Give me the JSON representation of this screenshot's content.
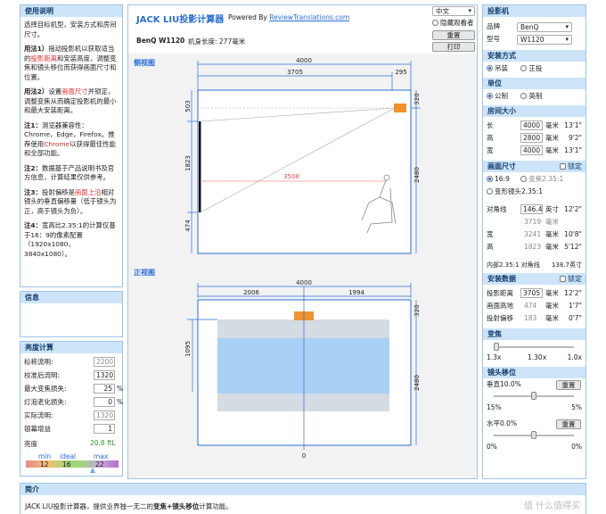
{
  "left": {
    "usage_title": "使用说明",
    "intro": "选择目标机型，安装方式和房间尺寸。",
    "method1_a": "用法1）",
    "method1_b": "拖动投影机以获取适当的",
    "method1_red": "投影距离",
    "method1_c": "和安装高度，调整变焦和镜头移位而获得画面尺寸和位置。",
    "method2_a": "用法2）",
    "method2_b": "设置",
    "method2_red": "画面尺寸",
    "method2_c": "并锁定，调整变焦从而确定投影机的最小和最大安装距离。",
    "note1_a": "注1：",
    "note1_b": "测览器兼容性：Chrome，Edge，Firefox。推荐使用",
    "note1_red": "Chrome",
    "note1_c": "以获得最佳性能和全部功能。",
    "note2_a": "注2：",
    "note2_b": "数据基于产品说明书及官方信息，计算结果仅供参考。",
    "note3_a": "注3：",
    "note3_b": "投射偏移是",
    "note3_red": "画面上沿",
    "note3_c": "相对镜头的垂直偏移量（低于镜头为正，高于镜头为负）。",
    "note4_a": "注4：",
    "note4_b": "宽高比2.35:1的计算仅基于16：9的像素配置（1920x1080，3840x1080）。",
    "info_title": "信息",
    "brightness_title": "亮度计算",
    "rows": [
      {
        "label": "标称流明:",
        "value": "2200",
        "unit": "",
        "dim": true
      },
      {
        "label": "校准后流明:",
        "value": "1320",
        "unit": "",
        "dim": false
      },
      {
        "label": "最大变焦损失:",
        "value": "25",
        "unit": "%",
        "dim": false
      },
      {
        "label": "灯泡老化损失:",
        "value": "0",
        "unit": "%",
        "dim": false
      },
      {
        "label": "实际流明:",
        "value": "1320",
        "unit": "",
        "dim": true
      },
      {
        "label": "银幕增益",
        "value": "1",
        "unit": "",
        "dim": false
      }
    ],
    "brightness_label": "亮度",
    "brightness_value": "20.8",
    "brightness_unit": "ftL",
    "scale_labels": [
      "min",
      "ideal",
      "max"
    ],
    "scale_values": [
      "12",
      "16",
      "22"
    ]
  },
  "center": {
    "title": "JACK LIU投影计算器",
    "powered": "Powered By",
    "powered_link": "ReviewTranslations.com",
    "model_line": "BenQ W1120",
    "lens_length": "机身长度: 277毫米",
    "lang": "中文",
    "hide_viewer": "隐藏观看者",
    "reset": "重置",
    "print": "打印",
    "side_title": "侧视图",
    "front_title": "正视图",
    "side": {
      "total": "4000",
      "dist": "3705",
      "proj": "295",
      "top_offset": "503",
      "screen_h": "1823",
      "bottom": "474",
      "view_dist": "3508",
      "room_h": "2480",
      "right_top": "320"
    },
    "front": {
      "total": "4000",
      "left": "2006",
      "right": "1994",
      "right_top": "320",
      "left_h": "1095",
      "room_h": "2480",
      "zero": "0"
    }
  },
  "right": {
    "proj_title": "投影机",
    "brand_label": "品牌",
    "brand": "BenQ",
    "model_label": "型号",
    "model": "W1120",
    "mount_title": "安装方式",
    "mount_options": [
      "吊装",
      "正投"
    ],
    "unit_title": "单位",
    "unit_options": [
      "公制",
      "英制"
    ],
    "room_title": "房间大小",
    "room_rows": [
      {
        "label": "长",
        "value": "4000",
        "unit": "毫米",
        "imp": "13'1\""
      },
      {
        "label": "高",
        "value": "2800",
        "unit": "毫米",
        "imp": "9'2\""
      },
      {
        "label": "宽",
        "value": "4000",
        "unit": "毫米",
        "imp": "13'1\""
      }
    ],
    "screen_title": "画面尺寸",
    "lock": "锁定",
    "ratio1": "16:9",
    "ratio2": "变焦2.35:1",
    "ratio3": "变形镜头2.35:1",
    "diag_label": "对角线",
    "diag_value": "146.4",
    "diag_unit": "英寸",
    "diag_imp": "12'2\"",
    "diag_mm": "3719",
    "diag_mm_unit": "毫米",
    "width_label": "宽",
    "width_value": "3241",
    "width_unit": "毫米",
    "width_imp": "10'8\"",
    "height_label": "高",
    "height_value": "1823",
    "height_unit": "毫米",
    "height_imp": "5'12\"",
    "inner_diag": "内部2.35:1 对角线",
    "inner_value": "138.7英寸",
    "install_title": "安装数据",
    "install_rows": [
      {
        "label": "投影距离",
        "value": "3705",
        "unit": "毫米",
        "imp": "12'2\""
      },
      {
        "label": "画面高地",
        "value": "474",
        "unit": "毫米",
        "imp": "1'7\""
      },
      {
        "label": "投射偏移",
        "value": "183",
        "unit": "毫米",
        "imp": "0'7\""
      }
    ],
    "zoom_title": "变焦",
    "zoom_labels": [
      "1.3x",
      "1.30x",
      "1.0x"
    ],
    "zoom_level": 0,
    "shift_title": "镜头移位",
    "vert_label": "垂直10.0%",
    "vert_left": "15%",
    "vert_right": "5%",
    "vert_level": 0.5,
    "horiz_label": "水平0.0%",
    "horiz_left": "0%",
    "horiz_right": "0%",
    "horiz_level": 0.5
  },
  "bottom": {
    "title": "简介",
    "text_a": "JACK LIU投影计算器，提供业界独一无二的",
    "text_b": "变焦+镜头移位",
    "text_c": "计算功能。",
    "watermark": "值 什么值得买"
  }
}
